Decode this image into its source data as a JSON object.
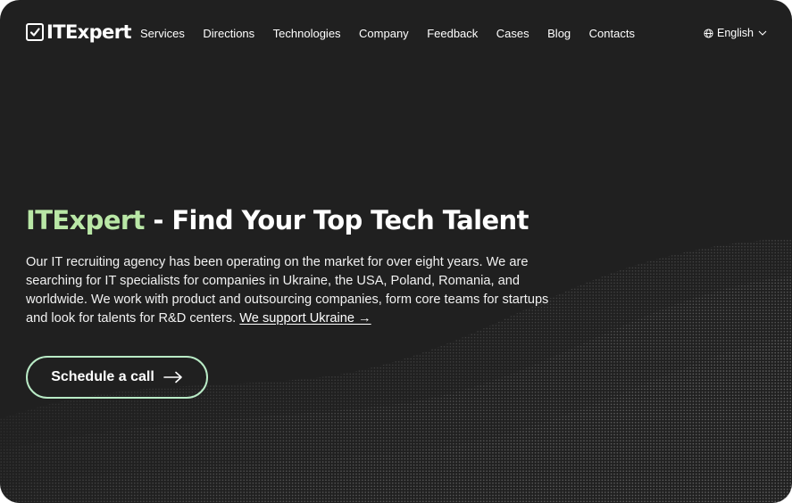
{
  "colors": {
    "background": "#202020",
    "accent_green": "#b9e7a6",
    "button_border": "#b9ebc6",
    "text": "#ffffff"
  },
  "header": {
    "logo_text": "ITExpert",
    "logo_icon": "checkbox-icon",
    "nav": [
      {
        "label": "Services"
      },
      {
        "label": "Directions"
      },
      {
        "label": "Technologies"
      },
      {
        "label": "Company"
      },
      {
        "label": "Feedback"
      },
      {
        "label": "Cases"
      },
      {
        "label": "Blog"
      },
      {
        "label": "Contacts"
      }
    ],
    "language": {
      "label": "English",
      "icon": "globe-icon",
      "dropdown_icon": "chevron-down-icon"
    }
  },
  "hero": {
    "title_brand": "ITExpert",
    "title_rest": " - Find Your Top Tech Talent",
    "description": "Our IT recruiting agency has been operating on the market for over eight years. We are searching for IT specialists for companies in Ukraine, the USA, Poland, Romania, and worldwide. We work with product and outsourcing companies, form core teams for startups and look for talents for R&D centers. ",
    "support_link": "We support Ukraine →",
    "cta_label": "Schedule a call",
    "cta_icon": "arrow-right-icon"
  }
}
